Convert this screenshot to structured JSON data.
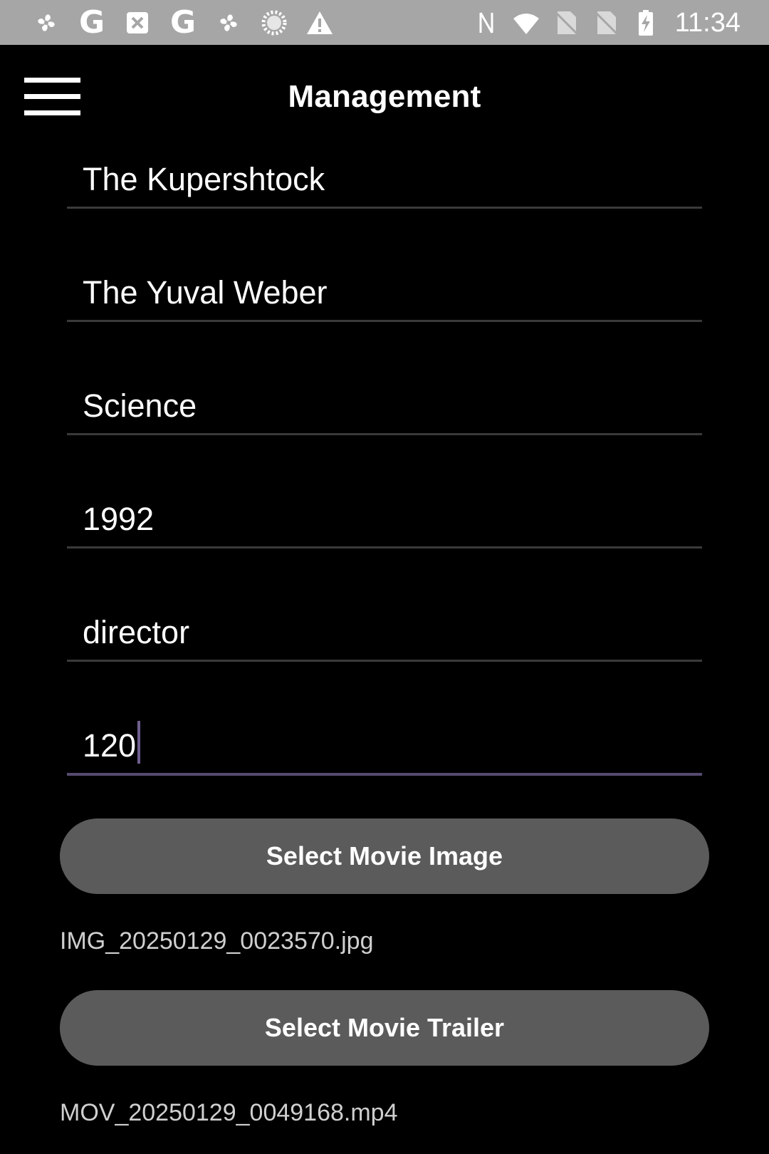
{
  "status_bar": {
    "left_icons": [
      "pinwheel-icon",
      "google-icon",
      "image-off-icon",
      "google-icon",
      "pinwheel-icon",
      "loading-circle-icon",
      "warning-icon"
    ],
    "right_icons": [
      "nfc-icon",
      "wifi-icon",
      "sim-off-icon",
      "sim-off-icon",
      "battery-charging-icon"
    ],
    "google_letter": "G",
    "time": "11:34"
  },
  "header": {
    "title": "Management"
  },
  "form": {
    "fields": [
      {
        "value": "The Kupershtock"
      },
      {
        "value": "The Yuval Weber"
      },
      {
        "value": "Science"
      },
      {
        "value": "1992"
      },
      {
        "value": "director"
      },
      {
        "value": "120",
        "focused": true
      }
    ]
  },
  "media": {
    "image_button_label": "Select Movie Image",
    "image_filename": "IMG_20250129_0023570.jpg",
    "trailer_button_label": "Select Movie Trailer",
    "trailer_filename": "MOV_20250129_0049168.mp4"
  },
  "colors": {
    "background": "#000000",
    "status_bar": "#a6a6a6",
    "button": "#5b5b5b",
    "focus_accent": "#574a70"
  }
}
